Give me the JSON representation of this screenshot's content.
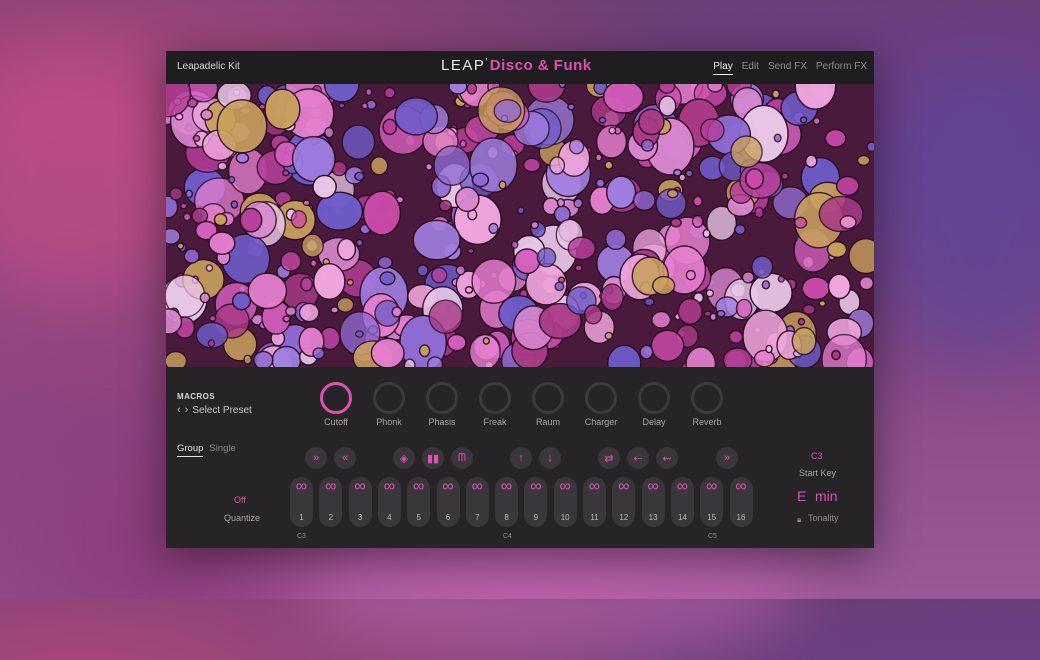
{
  "header": {
    "kit_name": "Leapadelic Kit",
    "brand_prefix": "LEAP",
    "brand_tick": "'",
    "brand_title": "Disco & Funk",
    "tabs": [
      {
        "label": "Play",
        "active": true
      },
      {
        "label": "Edit",
        "active": false
      },
      {
        "label": "Send FX",
        "active": false
      },
      {
        "label": "Perform FX",
        "active": false
      }
    ]
  },
  "macros": {
    "title": "MACROS",
    "preset_label": "Select Preset",
    "knobs": [
      "Cutoff",
      "Phonk",
      "Phasis",
      "Freak",
      "Raum",
      "Charger",
      "Delay",
      "Reverb"
    ]
  },
  "play": {
    "modes": [
      "Group",
      "Single"
    ],
    "active_mode": "Group",
    "quantize_value": "Off",
    "quantize_label": "Quantize",
    "slots": [
      "1",
      "2",
      "3",
      "4",
      "5",
      "6",
      "7",
      "8",
      "9",
      "10",
      "11",
      "12",
      "13",
      "14",
      "15",
      "16"
    ],
    "slot_icon": "∞",
    "octave_labels": [
      "C3",
      "C4",
      "C5"
    ],
    "start_key_value": "C3",
    "start_key_label": "Start Key",
    "key_note": "E",
    "key_mode": "min",
    "tonality_label": "Tonality",
    "buttons": [
      {
        "icon": "fast-forward-icon",
        "glyph": "»"
      },
      {
        "icon": "rewind-icon",
        "glyph": "«"
      },
      {
        "icon": "dice-icon",
        "glyph": "◈"
      },
      {
        "icon": "pause-bars-icon",
        "glyph": "▮▮"
      },
      {
        "icon": "envelope-icon",
        "glyph": "ᗰ"
      },
      {
        "icon": "arrow-up-icon",
        "glyph": "↑"
      },
      {
        "icon": "arrow-down-icon",
        "glyph": "↓"
      },
      {
        "icon": "swap-icon",
        "glyph": "⇄"
      },
      {
        "icon": "reverse-icon",
        "glyph": "⇠"
      },
      {
        "icon": "reverse-loop-icon",
        "glyph": "⇜"
      },
      {
        "icon": "skip-icon",
        "glyph": "»"
      }
    ]
  },
  "colors": {
    "accent": "#e04fb4",
    "panel": "#262427",
    "header": "#1f1d20"
  }
}
